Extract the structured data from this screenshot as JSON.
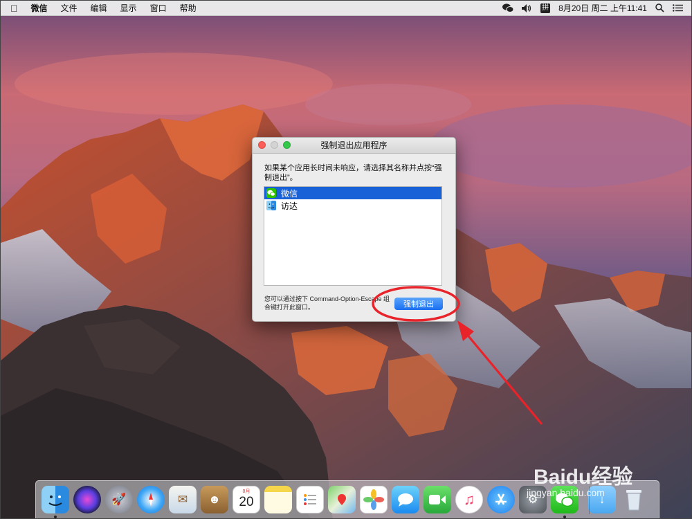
{
  "menubar": {
    "app_name": "微信",
    "menus": [
      "文件",
      "编辑",
      "显示",
      "窗口",
      "帮助"
    ],
    "ime_label": "拼",
    "datetime": "8月20日 周二 上午11:41"
  },
  "dialog": {
    "title": "强制退出应用程序",
    "prompt": "如果某个应用长时间未响应，请选择其名称并点按“强制退出”。",
    "apps": [
      {
        "name": "微信",
        "selected": true
      },
      {
        "name": "访达",
        "selected": false
      }
    ],
    "hint": "您可以通过按下 Command-Option-Escape 组合键打开此窗口。",
    "force_quit_label": "强制退出"
  },
  "dock": {
    "calendar": {
      "month": "8月",
      "day": "20"
    },
    "icons": [
      "finder-icon",
      "siri-icon",
      "launchpad-icon",
      "safari-icon",
      "mail-icon",
      "contacts-icon",
      "calendar-icon",
      "notes-icon",
      "reminders-icon",
      "maps-icon",
      "photos-icon",
      "messages-icon",
      "facetime-icon",
      "music-icon",
      "app-store-icon",
      "system-preferences-icon",
      "wechat-icon",
      "downloads-folder-icon",
      "trash-icon"
    ]
  },
  "watermark": {
    "text": "jingyan.baidu.com",
    "logo": "Baidu经验"
  },
  "colors": {
    "selection": "#1861d7",
    "button": "#1a6ff0",
    "annotation": "#e8232a"
  }
}
